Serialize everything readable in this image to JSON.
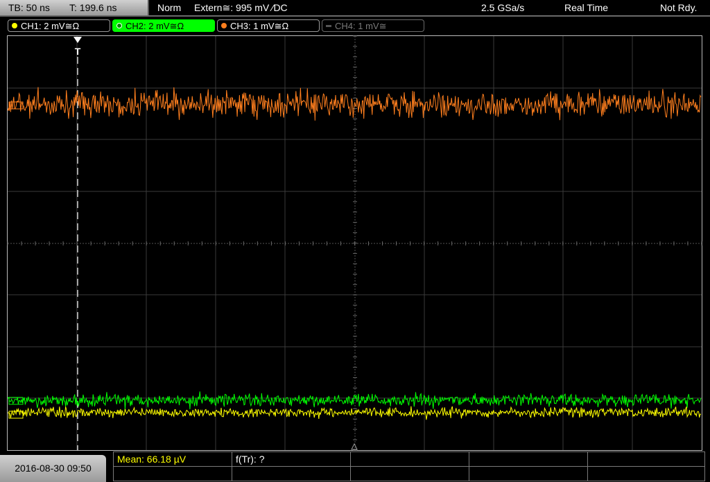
{
  "status_bar": {
    "tb": "TB: 50 ns",
    "trigger_time": "T: 199.6 ns",
    "mode": "Norm",
    "trigger_source": "Extern≅: 995 mV ⁄DC",
    "sample_rate": "2.5 GSa/s",
    "acq_mode": "Real Time",
    "state": "Not Rdy."
  },
  "channels": [
    {
      "label": "CH1: 2 mV≅Ω",
      "color": "#ffff00",
      "active": true
    },
    {
      "label": "CH2: 2 mV≅Ω",
      "color": "#00ff00",
      "active": true,
      "selected": true
    },
    {
      "label": "CH3: 1 mV≅Ω",
      "color": "#ff7f1e",
      "active": true
    },
    {
      "label": "CH4: 1 mV≅",
      "color": "#7a7a7a",
      "active": false
    }
  ],
  "trigger_marker": "T",
  "footer": {
    "datetime": "2016-08-30 09:50",
    "measurements": [
      {
        "label": "Mean: 66.18 µV",
        "color": "#ffff00"
      },
      {
        "label": "f(Tr): ?",
        "color": "#ffffff"
      }
    ]
  },
  "colors": {
    "ch1": "#ffff00",
    "ch2": "#00ff00",
    "ch3": "#ff7f1e",
    "grid": "#555555",
    "bezel": "#b0b0b0"
  }
}
